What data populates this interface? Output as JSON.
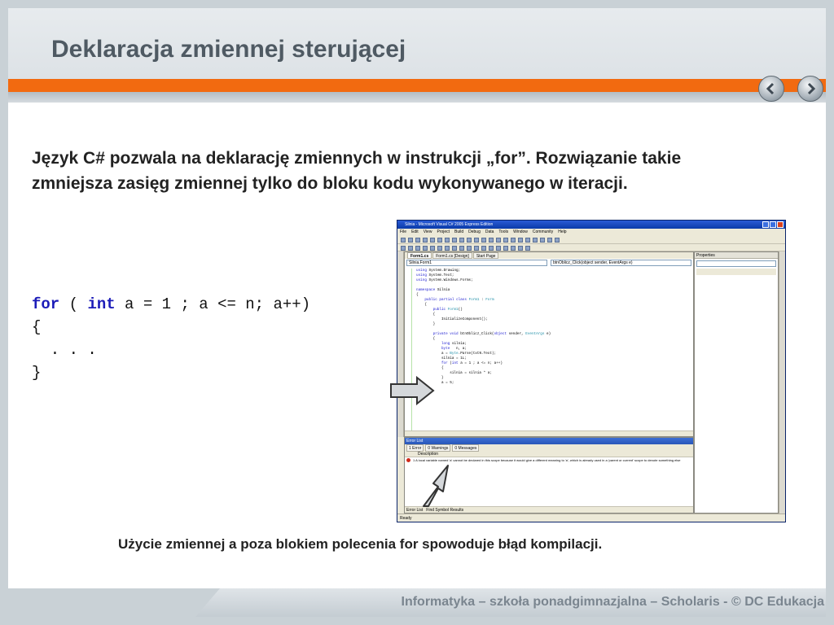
{
  "slide": {
    "title": "Deklaracja zmiennej sterującej",
    "intro": "Język C# pozwala na deklarację zmiennych w instrukcji „for”. Rozwiązanie takie zmniejsza zasięg zmiennej tylko do bloku kodu wykonywanego w iteracji.",
    "caption": "Użycie zmiennej a poza blokiem polecenia for spowoduje błąd kompilacji.",
    "footer": "Informatyka – szkoła ponadgimnazjalna – Scholaris - © DC Edukacja"
  },
  "code": {
    "kw_for": "for",
    "open_paren": "( ",
    "kw_int": "int",
    "rest": " a = 1 ; a <= n; a++)",
    "open_brace": "{",
    "ellipsis": "  . . .",
    "close_brace": "}"
  },
  "nav": {
    "prev_icon": "arrow-left-icon",
    "next_icon": "arrow-right-icon"
  },
  "ide": {
    "window_title": "Silnia - Microsoft Visual C# 2005 Express Edition",
    "menu": [
      "File",
      "Edit",
      "View",
      "Project",
      "Build",
      "Debug",
      "Data",
      "Tools",
      "Window",
      "Community",
      "Help"
    ],
    "tabs": [
      "Form1.cs",
      "Form1.cs [Design]",
      "Start Page"
    ],
    "combo_left": "Silnia.Form1",
    "combo_right": "btnOblicz_Click(object sender, EventArgs e)",
    "code_lines": [
      "using System.Drawing;",
      "using System.Text;",
      "using System.Windows.Forms;",
      "",
      "namespace Silnia",
      "{",
      "    public partial class Form1 : Form",
      "    {",
      "        public Form1()",
      "        {",
      "            InitializeComponent();",
      "        }",
      "",
      "        private void btnOblicz_Click(object sender, EventArgs e)",
      "        {",
      "            long silnia;",
      "            byte   n, a;",
      "            a = Byte.Parse(txtN.Text);",
      "            silnia = 1L;",
      "            for (int a = 1 ; a <= n; a++)",
      "            {",
      "                silnia = silnia * a;",
      "            }",
      "            a = 5;"
    ],
    "properties_title": "Properties",
    "error_list_title": "Error List",
    "error_tabs": [
      "1 Error",
      "0 Warnings",
      "0 Messages"
    ],
    "error_header": "Description",
    "error_row": "1   A local variable named 'a' cannot be declared in this scope because it would give a different meaning to 'a', which is already used in a 'parent or current' scope to denote something else",
    "bottom_tabs": [
      "Error List",
      "Find Symbol Results"
    ],
    "status": "Ready"
  }
}
